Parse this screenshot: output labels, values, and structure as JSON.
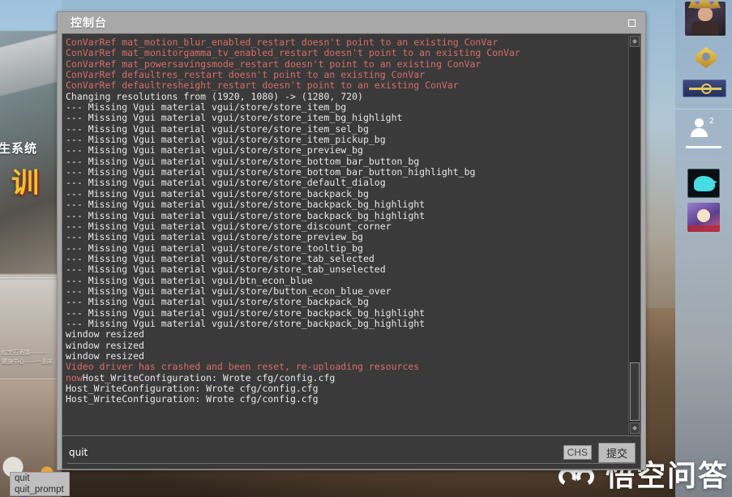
{
  "window": {
    "title": "控制台",
    "close_icon": "close-square-icon"
  },
  "console": {
    "lines": [
      {
        "text": "ConVarRef mat_motion_blur_enabled_restart doesn't point to an existing ConVar",
        "color": "red"
      },
      {
        "text": "ConVarRef mat_monitorgamma_tv_enabled_restart doesn't point to an existing ConVar",
        "color": "red"
      },
      {
        "text": "ConVarRef mat_powersavingsmode_restart doesn't point to an existing ConVar",
        "color": "red"
      },
      {
        "text": "ConVarRef defaultres_restart doesn't point to an existing ConVar",
        "color": "red"
      },
      {
        "text": "ConVarRef defaultresheight_restart doesn't point to an existing ConVar",
        "color": "red"
      },
      {
        "text": "Changing resolutions from (1920, 1080) -> (1280, 720)",
        "color": "white"
      },
      {
        "text": "--- Missing Vgui material vgui/store/store_item_bg",
        "color": "white"
      },
      {
        "text": "--- Missing Vgui material vgui/store/store_item_bg_highlight",
        "color": "white"
      },
      {
        "text": "--- Missing Vgui material vgui/store/store_item_sel_bg",
        "color": "white"
      },
      {
        "text": "--- Missing Vgui material vgui/store/store_item_pickup_bg",
        "color": "white"
      },
      {
        "text": "--- Missing Vgui material vgui/store/store_preview_bg",
        "color": "white"
      },
      {
        "text": "--- Missing Vgui material vgui/store/store_bottom_bar_button_bg",
        "color": "white"
      },
      {
        "text": "--- Missing Vgui material vgui/store/store_bottom_bar_button_highlight_bg",
        "color": "white"
      },
      {
        "text": "--- Missing Vgui material vgui/store/store_default_dialog",
        "color": "white"
      },
      {
        "text": "--- Missing Vgui material vgui/store/store_backpack_bg",
        "color": "white"
      },
      {
        "text": "--- Missing Vgui material vgui/store/store_backpack_bg_highlight",
        "color": "white"
      },
      {
        "text": "--- Missing Vgui material vgui/store/store_backpack_bg_highlight",
        "color": "white"
      },
      {
        "text": "--- Missing Vgui material vgui/store/store_discount_corner",
        "color": "white"
      },
      {
        "text": "--- Missing Vgui material vgui/store/store_preview_bg",
        "color": "white"
      },
      {
        "text": "--- Missing Vgui material vgui/store/store_tooltip_bg",
        "color": "white"
      },
      {
        "text": "--- Missing Vgui material vgui/store/store_tab_selected",
        "color": "white"
      },
      {
        "text": "--- Missing Vgui material vgui/store/store_tab_unselected",
        "color": "white"
      },
      {
        "text": "--- Missing Vgui material vgui/btn_econ_blue",
        "color": "white"
      },
      {
        "text": "--- Missing Vgui material vgui/store/button_econ_blue_over",
        "color": "white"
      },
      {
        "text": "--- Missing Vgui material vgui/store/store_backpack_bg",
        "color": "white"
      },
      {
        "text": "--- Missing Vgui material vgui/store/store_backpack_bg_highlight",
        "color": "white"
      },
      {
        "text": "--- Missing Vgui material vgui/store/store_backpack_bg_highlight",
        "color": "white"
      },
      {
        "text": "window resized",
        "color": "white"
      },
      {
        "text": "window resized",
        "color": "white"
      },
      {
        "text": "window resized",
        "color": "white"
      },
      {
        "text": "Video driver has crashed and been reset, re-uploading resources",
        "color": "red"
      },
      {
        "text": "now",
        "color": "red",
        "continuation": "Host_WriteConfiguration: Wrote cfg/config.cfg"
      },
      {
        "text": "Host_WriteConfiguration: Wrote cfg/config.cfg",
        "color": "white"
      },
      {
        "text": "Host_WriteConfiguration: Wrote cfg/config.cfg",
        "color": "white"
      }
    ],
    "colors": {
      "log_background": "#3a3a3a",
      "text_white": "#e8e8e8",
      "text_red": "#d96b6b",
      "window_chrome": "#a8a8a8"
    },
    "scrollbar": {
      "up_arrow_icon": "scroll-up-icon",
      "down_arrow_icon": "scroll-down-icon"
    }
  },
  "input": {
    "value": "quit",
    "placeholder": "",
    "ime_label": "CHS",
    "submit_label": "提交"
  },
  "autocomplete": {
    "items": [
      {
        "label": "quit"
      },
      {
        "label": "quit_prompt"
      }
    ]
  },
  "background": {
    "heading_cn": "生系统",
    "big_cn": "训",
    "caption_line_1": "红宝石酒镇———",
    "caption_line_2": "健身中心——一张床"
  },
  "right_rail": {
    "avatar_name": "user-avatar",
    "rank_badge_name": "rank-chevron-badge",
    "weapon_badge_name": "weapon-badge",
    "friends_count": "2",
    "app_1_name": "bird-app-icon",
    "app_2_name": "anime-app-icon"
  },
  "watermark": {
    "text": "悟空问答",
    "logo_name": "wukong-cloud-logo"
  }
}
